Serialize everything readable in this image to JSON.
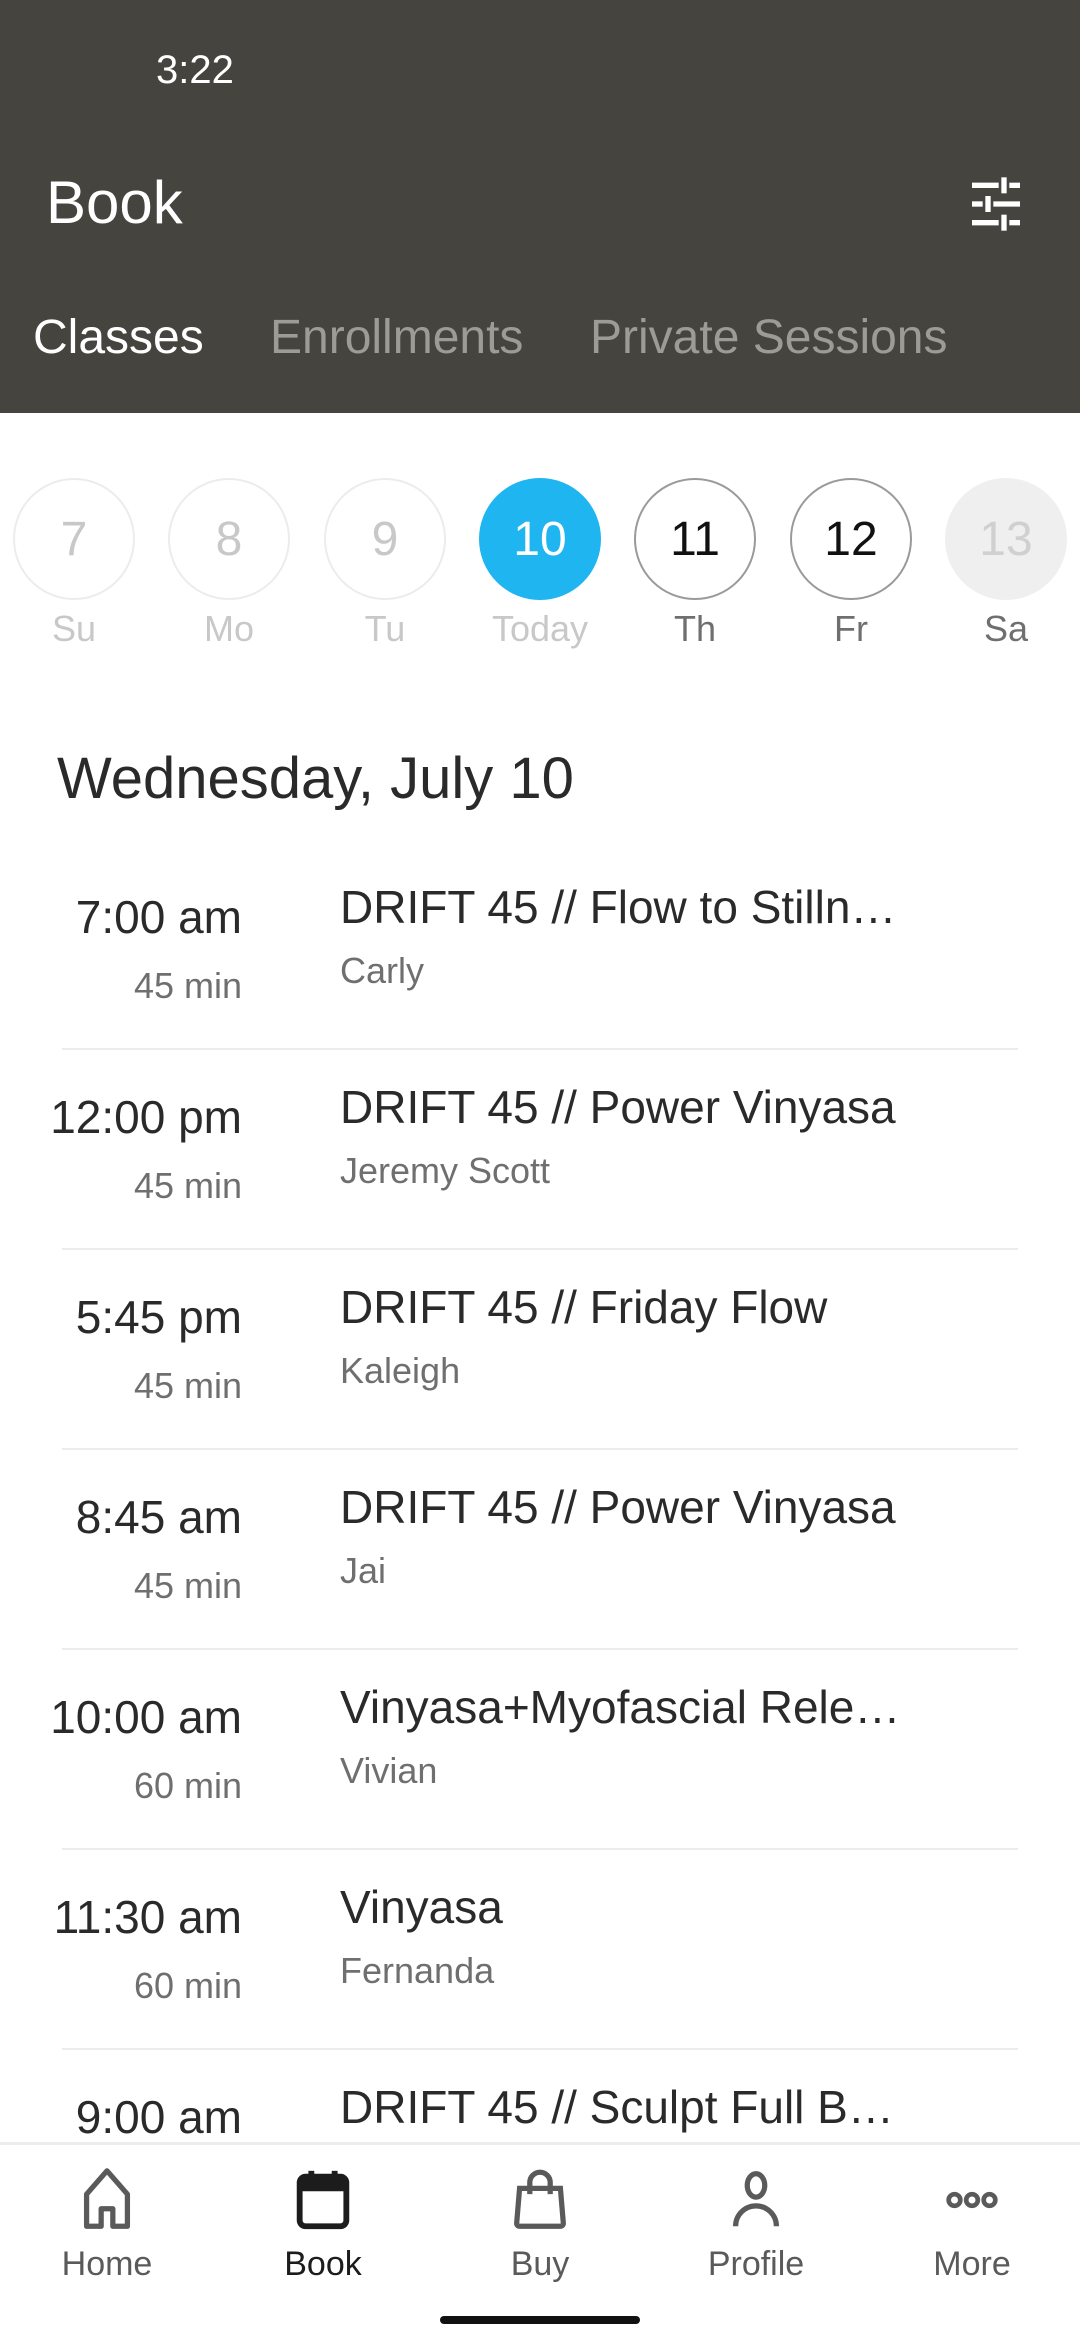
{
  "status_bar": {
    "time": "3:22"
  },
  "header": {
    "title": "Book",
    "filter_icon": "tune-sliders-icon"
  },
  "tabs": [
    {
      "label": "Classes",
      "active": true
    },
    {
      "label": "Enrollments",
      "active": false
    },
    {
      "label": "Private Sessions",
      "active": false
    }
  ],
  "date_strip": [
    {
      "day": "7",
      "label": "Su",
      "state": "past"
    },
    {
      "day": "8",
      "label": "Mo",
      "state": "past"
    },
    {
      "day": "9",
      "label": "Tu",
      "state": "past"
    },
    {
      "day": "10",
      "label": "Today",
      "state": "today"
    },
    {
      "day": "11",
      "label": "Th",
      "state": "upcoming"
    },
    {
      "day": "12",
      "label": "Fr",
      "state": "upcoming"
    },
    {
      "day": "13",
      "label": "Sa",
      "state": "disabled"
    }
  ],
  "day_heading": "Wednesday, July 10",
  "classes": [
    {
      "time": "7:00 am",
      "duration": "45 min",
      "name": "DRIFT 45 // Flow to Stilln…",
      "instructor": "Carly"
    },
    {
      "time": "12:00 pm",
      "duration": "45 min",
      "name": "DRIFT 45 // Power Vinyasa",
      "instructor": "Jeremy Scott"
    },
    {
      "time": "5:45 pm",
      "duration": "45 min",
      "name": "DRIFT 45 // Friday Flow",
      "instructor": "Kaleigh"
    },
    {
      "time": "8:45 am",
      "duration": "45 min",
      "name": "DRIFT 45 // Power Vinyasa",
      "instructor": "Jai"
    },
    {
      "time": "10:00 am",
      "duration": "60 min",
      "name": "Vinyasa+Myofascial Rele…",
      "instructor": "Vivian"
    },
    {
      "time": "11:30 am",
      "duration": "60 min",
      "name": "Vinyasa",
      "instructor": "Fernanda"
    },
    {
      "time": "9:00 am",
      "duration": "",
      "name": "DRIFT 45 // Sculpt Full B…",
      "instructor": ""
    }
  ],
  "bottom_nav": [
    {
      "label": "Home",
      "icon": "home-icon",
      "active": false
    },
    {
      "label": "Book",
      "icon": "calendar-icon",
      "active": true
    },
    {
      "label": "Buy",
      "icon": "shopping-bag-icon",
      "active": false
    },
    {
      "label": "Profile",
      "icon": "person-icon",
      "active": false
    },
    {
      "label": "More",
      "icon": "more-dots-icon",
      "active": false
    }
  ],
  "colors": {
    "header_bg": "#45443e",
    "accent": "#1fb5f0"
  }
}
